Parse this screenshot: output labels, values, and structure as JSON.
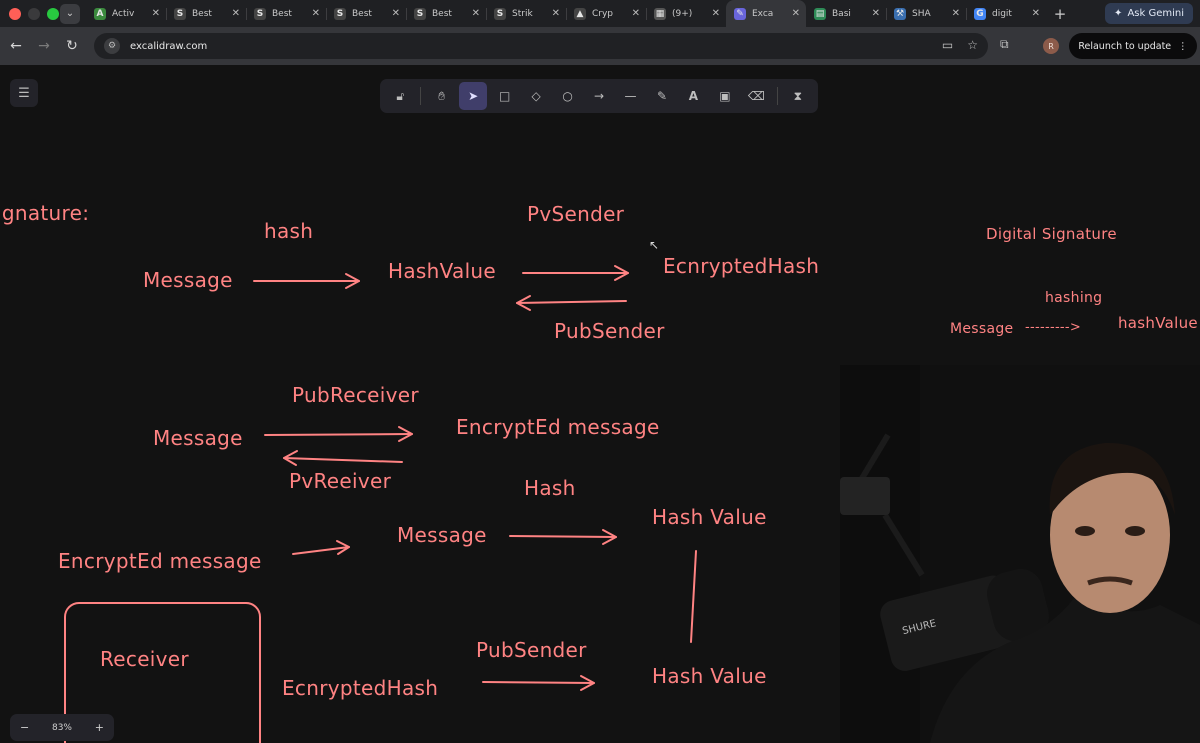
{
  "browser": {
    "tabs": [
      {
        "label": "Activ",
        "favicon": "A",
        "color": "#3b8a3e",
        "active": false
      },
      {
        "label": "Best",
        "favicon": "S",
        "color": "#444",
        "active": false
      },
      {
        "label": "Best",
        "favicon": "S",
        "color": "#444",
        "active": false
      },
      {
        "label": "Best",
        "favicon": "S",
        "color": "#444",
        "active": false
      },
      {
        "label": "Best",
        "favicon": "S",
        "color": "#444",
        "active": false
      },
      {
        "label": "Strik",
        "favicon": "S",
        "color": "#444",
        "active": false
      },
      {
        "label": "Cryp",
        "favicon": "▲",
        "color": "#444",
        "active": false
      },
      {
        "label": "(9+)",
        "favicon": "▦",
        "color": "#555",
        "active": false
      },
      {
        "label": "Exca",
        "favicon": "✎",
        "color": "#6965db",
        "active": true
      },
      {
        "label": "Basi",
        "favicon": "▤",
        "color": "#2e8b57",
        "active": false
      },
      {
        "label": "SHA",
        "favicon": "⚒",
        "color": "#3a6fb0",
        "active": false
      },
      {
        "label": "digit",
        "favicon": "G",
        "color": "#4285f4",
        "active": false
      }
    ],
    "gemini_label": "Ask Gemini",
    "url": "excalidraw.com",
    "profile_initial": "R",
    "relaunch_label": "Relaunch to update"
  },
  "zoom": {
    "minus": "−",
    "value": "83%",
    "plus": "+"
  },
  "drawing": {
    "sig_heading": "ignature:",
    "r1_hash": "hash",
    "r1_message": "Message",
    "r1_hashvalue": "HashValue",
    "r1_pvsender": "PvSender",
    "r1_encrypted_hash": "EcnryptedHash",
    "r1_pubsender": "PubSender",
    "ds_title": "Digital Signature",
    "ds_hashing": "hashing",
    "ds_message": "Message",
    "ds_arrow": "--------->",
    "ds_hashvalue": "hashValue",
    "r2_pubreceiver": "PubReceiver",
    "r2_message": "Message",
    "r2_encrypted_message": "EncryptEd message",
    "r2_pvreceiver": "PvReeiver",
    "r3_hash": "Hash",
    "r3_hash_value": "Hash Value",
    "r3_encrypted_message": "EncryptEd message",
    "r3_message": "Message",
    "receiver_label": "Receiver",
    "r4_encrypted_hash": "EcnryptedHash",
    "r4_pubsender": "PubSender",
    "r4_hash_value": "Hash Value"
  }
}
